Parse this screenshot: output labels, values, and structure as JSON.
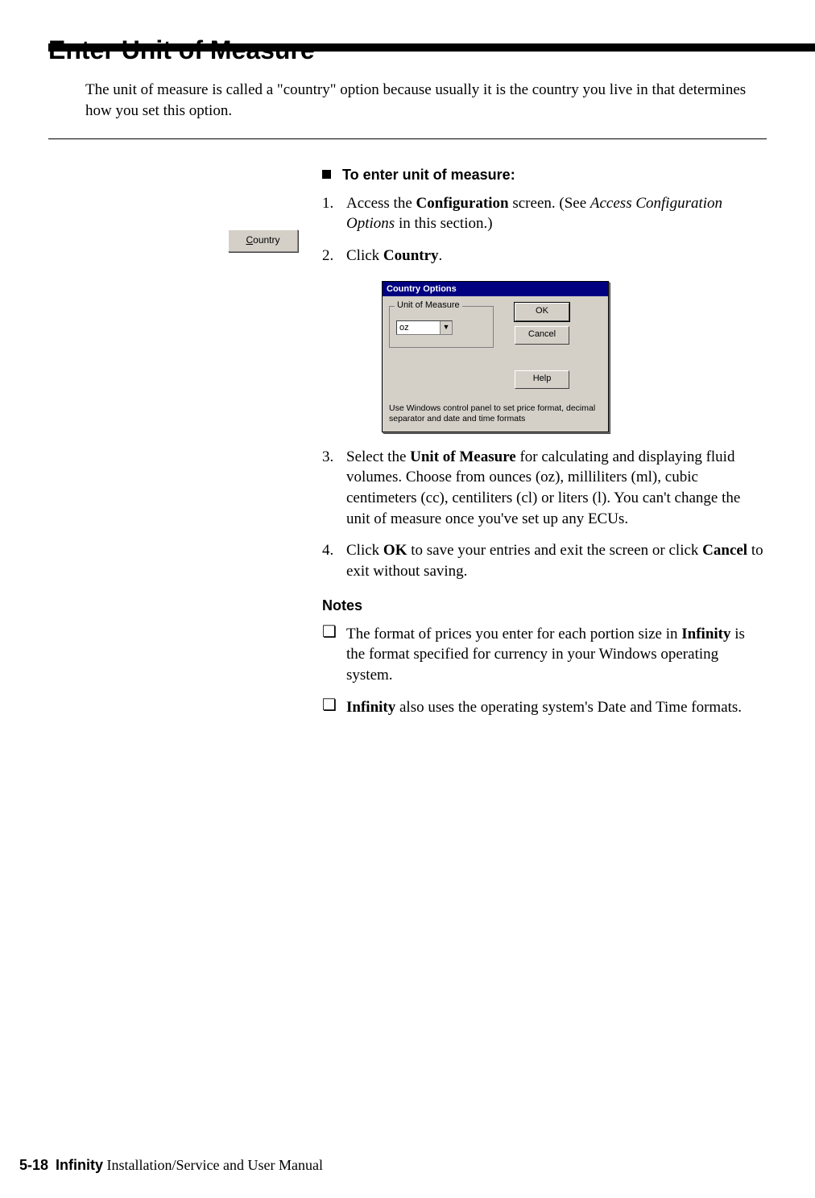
{
  "heading": "Enter Unit of Measure",
  "intro": "The unit of measure is called a \"country\" option because usually it is the country you live in that determines how you set this option.",
  "procedure_title": "To enter unit of measure:",
  "country_button": {
    "mnemonic_letter": "C",
    "rest": "ountry"
  },
  "dialog": {
    "title": "Country Options",
    "group_label": "Unit of Measure",
    "selected_value": "oz",
    "ok": "OK",
    "cancel": "Cancel",
    "help": "Help",
    "hint": "Use Windows control panel to set price format, decimal separator and date and time formats"
  },
  "steps": {
    "s1_pre": "Access the ",
    "s1_b1": "Configuration",
    "s1_mid": " screen. (See ",
    "s1_i1": "Access Configuration Options",
    "s1_post": " in this section.)",
    "s2_pre": "Click ",
    "s2_b1": "Country",
    "s2_post": ".",
    "s3_pre": "Select the ",
    "s3_b1": "Unit of Measure",
    "s3_post": " for calculating and displaying fluid volumes. Choose from ounces (oz), milliliters (ml), cubic centimeters (cc), centiliters (cl) or liters (l). You can't change the unit of measure once you've set up any ECUs.",
    "s4_pre": "Click ",
    "s4_b1": "OK",
    "s4_mid": " to save your entries and exit the screen or click ",
    "s4_b2": "Cancel",
    "s4_post": " to exit without saving."
  },
  "notes_heading": "Notes",
  "notes": {
    "n1_pre": "The format of prices you enter for each portion size in ",
    "n1_b1": "Infinity",
    "n1_post": " is the format specified for currency in your Windows operating system.",
    "n2_b1": "Infinity",
    "n2_post": " also uses the operating system's Date and Time formats."
  },
  "footer": {
    "page": "5-18",
    "product": "Infinity",
    "rest": " Installation/Service and User Manual"
  }
}
